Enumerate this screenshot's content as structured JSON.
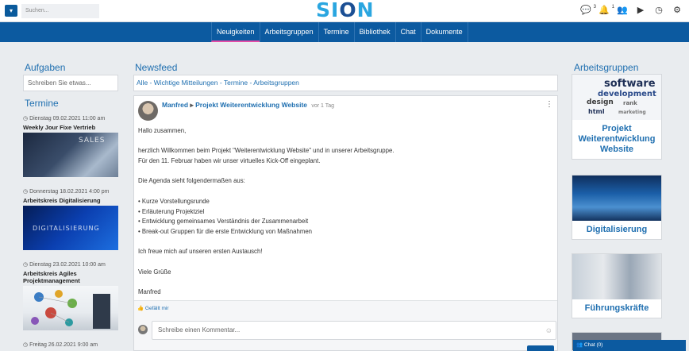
{
  "header": {
    "menu_icon": "menu-icon",
    "search_placeholder": "Suchen...",
    "logo": "SION",
    "icons": [
      {
        "name": "messages-icon",
        "badge": "3"
      },
      {
        "name": "notifications-icon",
        "badge": "1"
      },
      {
        "name": "groups-icon",
        "badge": ""
      },
      {
        "name": "video-icon",
        "badge": ""
      },
      {
        "name": "clock-icon",
        "badge": ""
      },
      {
        "name": "settings-icon",
        "badge": ""
      }
    ]
  },
  "nav": {
    "items": [
      "Neuigkeiten",
      "Arbeitsgruppen",
      "Termine",
      "Bibliothek",
      "Chat",
      "Dokumente"
    ],
    "active": "Neuigkeiten",
    "active_color": "#e44ca7",
    "bar_color": "#0c5aa0"
  },
  "left": {
    "tasks_heading": "Aufgaben",
    "task_placeholder": "Schreiben Sie etwas...",
    "events_heading": "Termine",
    "events": [
      {
        "date": "Dienstag 09.02.2021 11:00 am",
        "title": "Weekly Jour Fixe Vertrieb",
        "image_text": "SALES"
      },
      {
        "date": "Donnerstag 18.02.2021 4:00 pm",
        "title": "Arbeitskreis Digitalisierung",
        "image_text": "DIGITALISIERUNG"
      },
      {
        "date": "Dienstag 23.02.2021 10:00 am",
        "title": "Arbeitskreis Agiles Projektmanagement",
        "image_text": ""
      }
    ],
    "last_date": "Freitag 26.02.2021 9:00 am"
  },
  "newsfeed": {
    "heading": "Newsfeed",
    "filter_text": "Alle - Wichtige Mitteilungen - Termine - Arbeitsgruppen",
    "post": {
      "author": "Manfred",
      "group": "Projekt Weiterentwicklung Website",
      "time": "vor 1 Tag",
      "lines": [
        "Hallo zusammen,",
        "",
        "herzlich Willkommen beim Projekt \"Weiterentwicklung Website\" und in unserer Arbeitsgruppe.",
        "Für den 11. Februar haben wir unser virtuelles Kick-Off eingeplant.",
        "",
        "Die Agenda sieht folgendermaßen aus:",
        "",
        "• Kurze Vorstellungsrunde",
        "• Erläuterung Projektziel",
        "• Entwicklung gemeinsames Verständnis der Zusammenarbeit",
        "• Break-out Gruppen für die erste Entwicklung von Maßnahmen",
        "",
        "Ich freue mich auf unseren ersten Austausch!",
        "",
        "Viele Grüße",
        "",
        "Manfred"
      ],
      "like_label": "Gefällt mir",
      "comment_placeholder": "Schreibe einen Kommentar..."
    }
  },
  "right": {
    "heading": "Arbeitsgruppen",
    "groups": [
      {
        "title": "Projekt Weiterentwicklung Website",
        "image_words": [
          "software",
          "development",
          "design",
          "html",
          "rank",
          "marketing"
        ]
      },
      {
        "title": "Digitalisierung"
      },
      {
        "title": "Führungskräfte"
      }
    ]
  },
  "chat": {
    "label": "Chat (0)"
  }
}
